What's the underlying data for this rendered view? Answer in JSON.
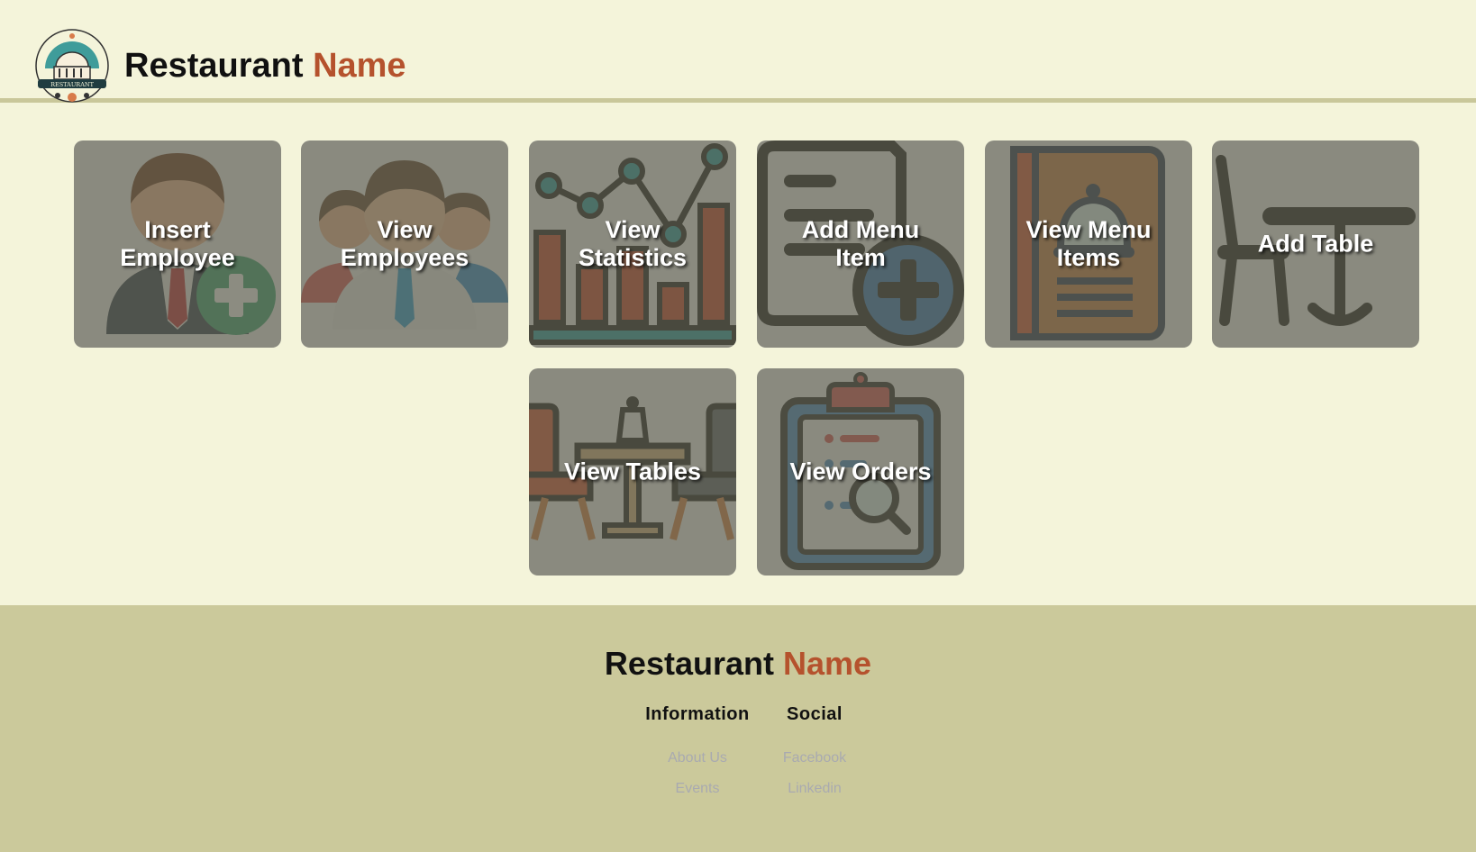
{
  "header": {
    "brand_main": "Restaurant",
    "brand_accent": "Name",
    "logo_text": "RESTAURANT"
  },
  "tiles": [
    {
      "label": "Insert Employee",
      "icon": "add-employee-icon"
    },
    {
      "label": "View Employees",
      "icon": "employees-icon"
    },
    {
      "label": "View Statistics",
      "icon": "statistics-chart-icon"
    },
    {
      "label": "Add Menu Item",
      "icon": "add-document-icon"
    },
    {
      "label": "View Menu Items",
      "icon": "menu-book-icon"
    },
    {
      "label": "Add Table",
      "icon": "table-chair-icon"
    },
    {
      "label": "View Tables",
      "icon": "dining-table-icon"
    },
    {
      "label": "View Orders",
      "icon": "clipboard-search-icon"
    }
  ],
  "footer": {
    "brand_main": "Restaurant",
    "brand_accent": "Name",
    "information": {
      "title": "Information",
      "links": [
        "About Us",
        "Events"
      ]
    },
    "social": {
      "title": "Social",
      "links": [
        "Facebook",
        "Linkedin"
      ]
    }
  },
  "colors": {
    "background": "#f4f4da",
    "accent": "#b5522d",
    "footer": "#cbc99b"
  }
}
